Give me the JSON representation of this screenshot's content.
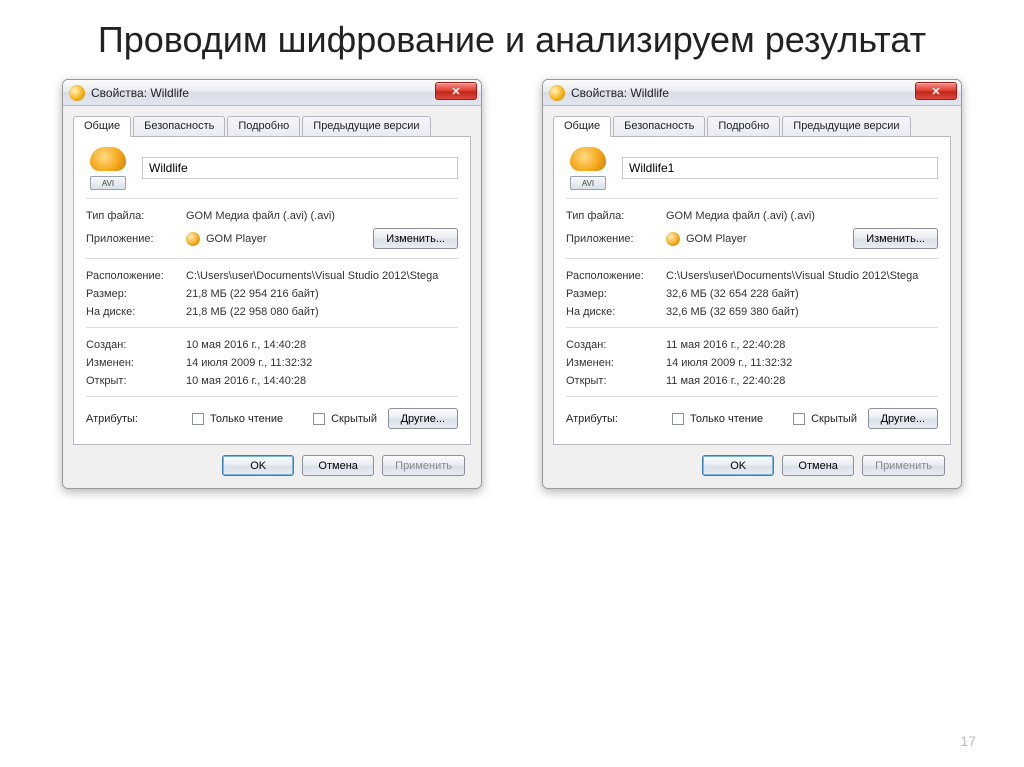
{
  "slide": {
    "title": "Проводим шифрование и анализируем результат",
    "page_number": "17"
  },
  "common": {
    "tabs": {
      "general": "Общие",
      "security": "Безопасность",
      "details": "Подробно",
      "prev": "Предыдущие версии"
    },
    "labels": {
      "filetype": "Тип файла:",
      "app": "Приложение:",
      "change": "Изменить...",
      "location": "Расположение:",
      "size": "Размер:",
      "size_on_disk": "На диске:",
      "created": "Создан:",
      "modified": "Изменен:",
      "accessed": "Открыт:",
      "attributes": "Атрибуты:",
      "readonly": "Только чтение",
      "hidden": "Скрытый",
      "other": "Другие...",
      "ok": "OK",
      "cancel": "Отмена",
      "apply": "Применить",
      "avi_badge": "AVI",
      "close_glyph": "✕"
    },
    "filetype_value": "GOM Медиа файл (.avi) (.avi)",
    "app_value": "GOM Player",
    "location": "C:\\Users\\user\\Documents\\Visual Studio 2012\\Stega"
  },
  "left": {
    "title": "Свойства: Wildlife",
    "filename": "Wildlife",
    "size": "21,8 МБ (22 954 216 байт)",
    "size_on_disk": "21,8 МБ (22 958 080 байт)",
    "created": "10 мая 2016 г., 14:40:28",
    "modified": "14 июля 2009 г., 11:32:32",
    "accessed": "10 мая 2016 г., 14:40:28"
  },
  "right": {
    "title": "Свойства: Wildlife",
    "filename": "Wildlife1",
    "size": "32,6 МБ (32 654 228 байт)",
    "size_on_disk": "32,6 МБ (32 659 380 байт)",
    "created": "11 мая 2016 г., 22:40:28",
    "modified": "14 июля 2009 г., 11:32:32",
    "accessed": "11 мая 2016 г., 22:40:28"
  }
}
